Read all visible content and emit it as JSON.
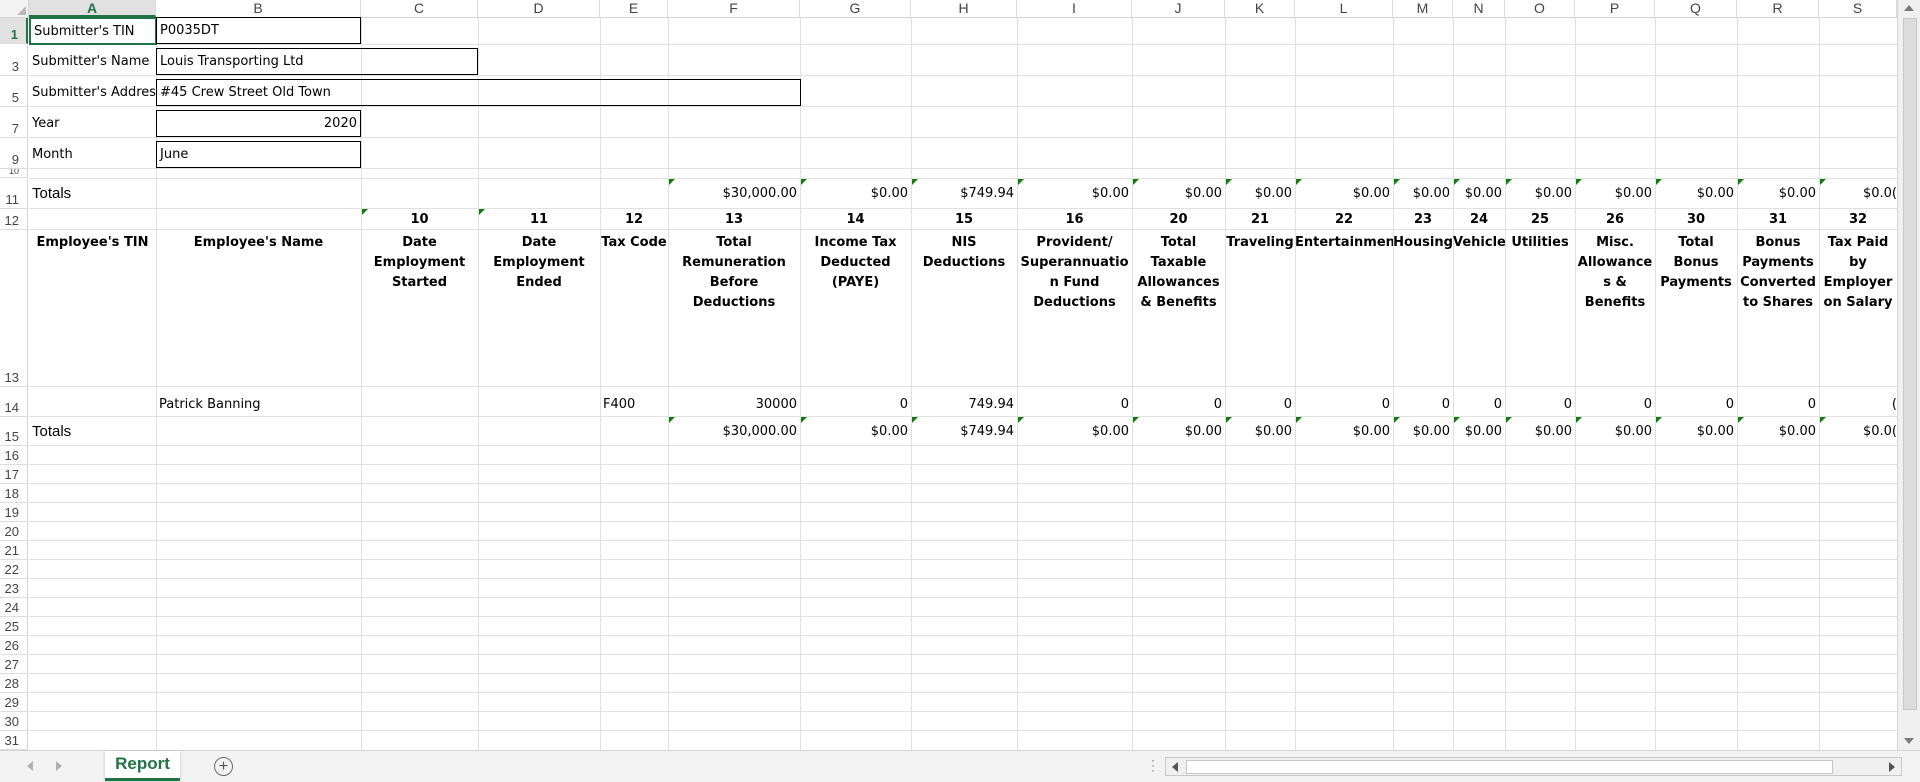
{
  "columns": [
    "A",
    "B",
    "C",
    "D",
    "E",
    "F",
    "G",
    "H",
    "I",
    "J",
    "K",
    "L",
    "M",
    "N",
    "O",
    "P",
    "Q",
    "R",
    "S"
  ],
  "active_column": "A",
  "rows": [
    "1",
    "3",
    "5",
    "7",
    "9",
    "10",
    "11",
    "12",
    "13",
    "14",
    "15",
    "16",
    "17",
    "18",
    "19",
    "20",
    "21",
    "22",
    "23",
    "24",
    "25",
    "26",
    "27",
    "28",
    "29",
    "30",
    "31"
  ],
  "active_row": "1",
  "submitter": {
    "tin_label": "Submitter's TIN",
    "tin_value": "P0035DT",
    "name_label": "Submitter's Name",
    "name_value": "Louis Transporting Ltd",
    "address_label": "Submitter's Addres",
    "address_value": "#45 Crew Street Old Town",
    "year_label": "Year",
    "year_value": "2020",
    "month_label": "Month",
    "month_value": "June"
  },
  "totals_label": "Totals",
  "totals_top": [
    "$30,000.00",
    "$0.00",
    "$749.94",
    "$0.00",
    "$0.00",
    "$0.00",
    "$0.00",
    "$0.00",
    "$0.00",
    "$0.00",
    "$0.00",
    "$0.00",
    "$0.00",
    "$0.0("
  ],
  "header_numbers": [
    "10",
    "11",
    "12",
    "13",
    "14",
    "15",
    "16",
    "20",
    "21",
    "22",
    "23",
    "24",
    "25",
    "26",
    "30",
    "31",
    "32"
  ],
  "header_titles": [
    "Employee's TIN",
    "Employee's Name",
    "Date\nEmployment\nStarted",
    "Date\nEmployment\nEnded",
    "Tax Code",
    "Total\nRemuneration\nBefore Deductions",
    "Income Tax\nDeducted\n(PAYE)",
    "NIS Deductions",
    "Provident/\nSuperannuatio\nn Fund\nDeductions",
    "Total\nTaxable\nAllowances\n& Benefits",
    "Traveling",
    "Entertainment",
    "Housing",
    "Vehicle",
    "Utilities",
    "Misc.\nAllowance\ns &\nBenefits",
    "Total\nBonus\nPayments",
    "Bonus\nPayments\nConverted\nto Shares",
    "Tax Paid\nby\nEmployer\non Salary"
  ],
  "employee_row": {
    "name": "Patrick Banning",
    "tax_code": "F400",
    "values": [
      "30000",
      "0",
      "749.94",
      "0",
      "0",
      "0",
      "0",
      "0",
      "0",
      "0",
      "0",
      "0",
      "0",
      "("
    ]
  },
  "totals_bottom": [
    "$30,000.00",
    "$0.00",
    "$749.94",
    "$0.00",
    "$0.00",
    "$0.00",
    "$0.00",
    "$0.00",
    "$0.00",
    "$0.00",
    "$0.00",
    "$0.00",
    "$0.00",
    "$0.0("
  ],
  "sheet_tab": "Report",
  "add_sheet": "+",
  "tab_dots": "⋮",
  "colors": {
    "excel_green": "#217346",
    "error_triangle": "#107c10",
    "grid": "#e1e1e1"
  }
}
